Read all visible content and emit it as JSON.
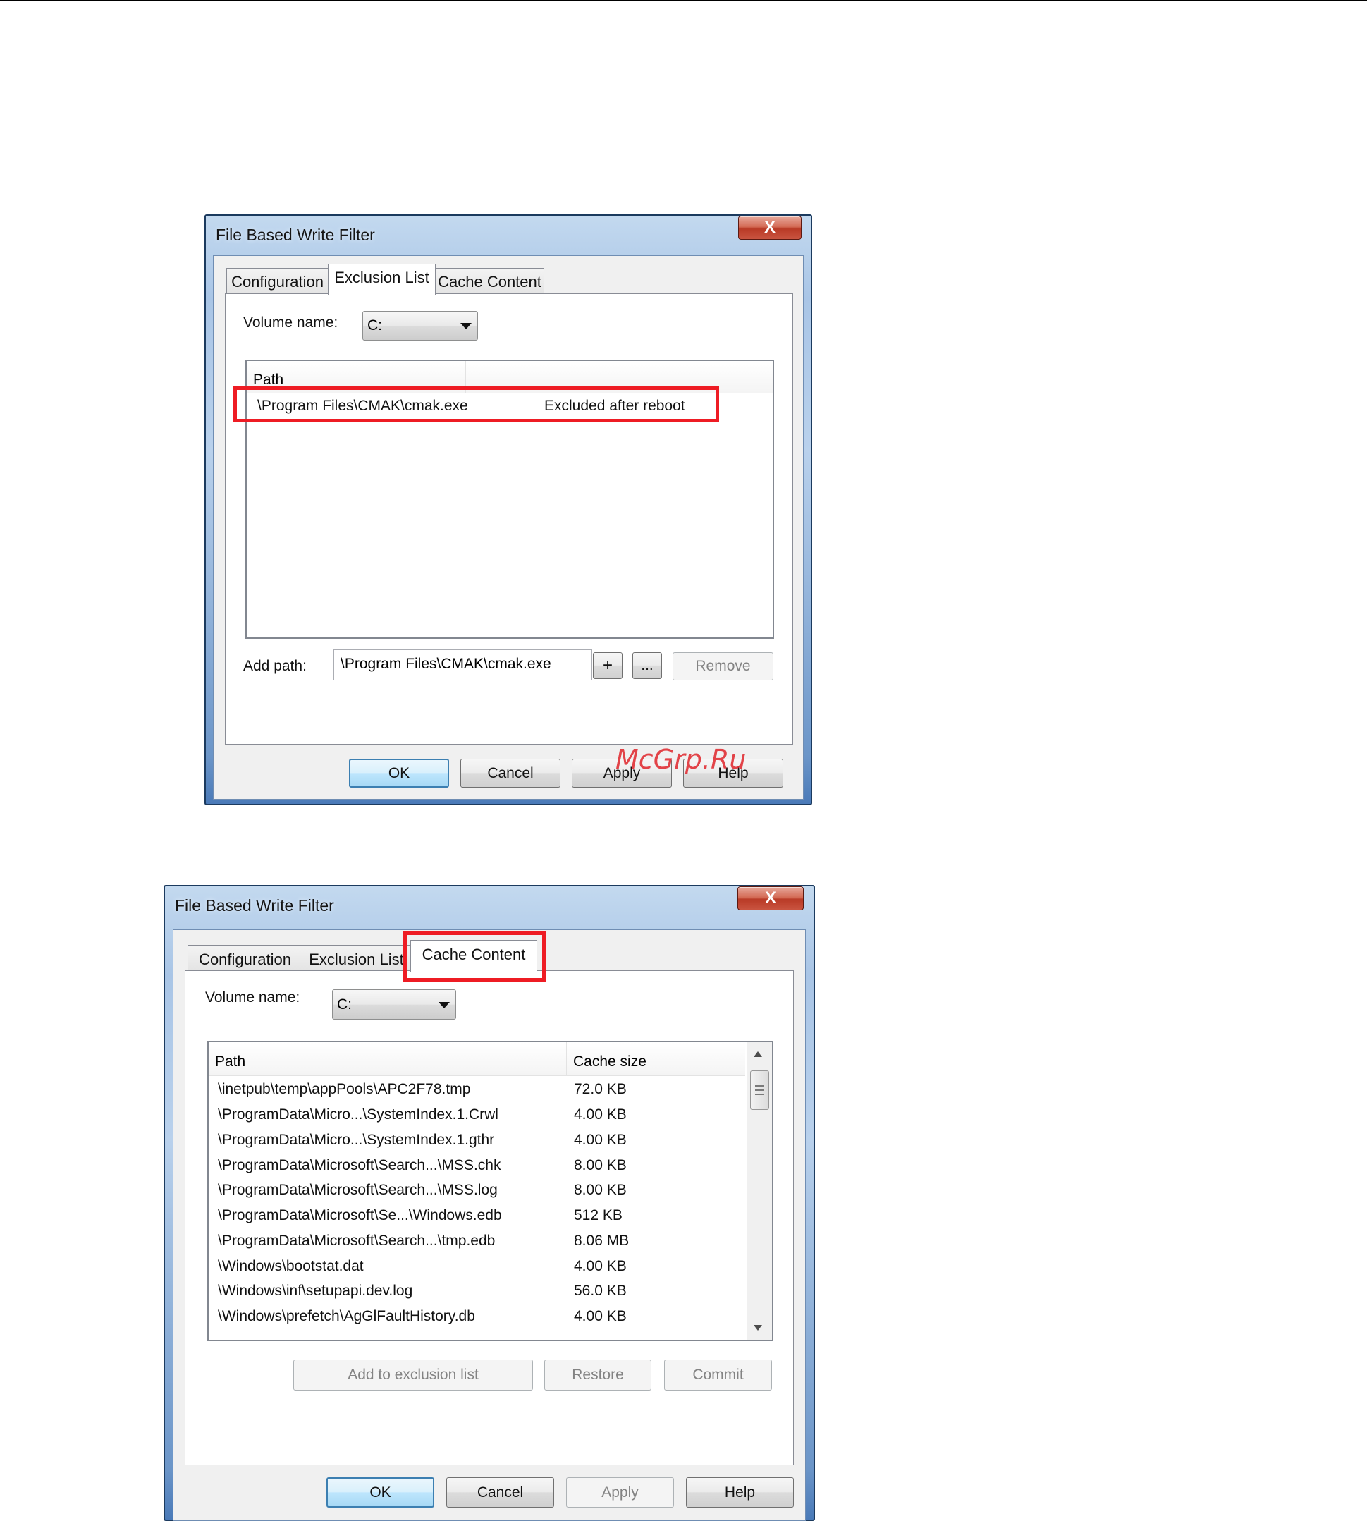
{
  "window_title": "File Based Write Filter",
  "close_glyph": "X",
  "tabs": [
    "Configuration",
    "Exclusion List",
    "Cache Content"
  ],
  "volume_label": "Volume name:",
  "volume_value": "C:",
  "watermark": "McGrp.Ru",
  "dialog1": {
    "list_header_path": "Path",
    "rows": [
      {
        "path": "\\Program Files\\CMAK\\cmak.exe",
        "status": "Excluded after reboot"
      }
    ],
    "add_path_label": "Add path:",
    "add_path_value": "\\Program Files\\CMAK\\cmak.exe",
    "add_button": "+",
    "browse_button": "...",
    "remove_button": "Remove",
    "buttons": {
      "ok": "OK",
      "cancel": "Cancel",
      "apply": "Apply",
      "help": "Help"
    }
  },
  "dialog2": {
    "header_path": "Path",
    "header_size": "Cache size",
    "rows": [
      {
        "path": "\\inetpub\\temp\\appPools\\APC2F78.tmp",
        "size": "72.0 KB"
      },
      {
        "path": "\\ProgramData\\Micro...\\SystemIndex.1.Crwl",
        "size": "4.00 KB"
      },
      {
        "path": "\\ProgramData\\Micro...\\SystemIndex.1.gthr",
        "size": "4.00 KB"
      },
      {
        "path": "\\ProgramData\\Microsoft\\Search...\\MSS.chk",
        "size": "8.00 KB"
      },
      {
        "path": "\\ProgramData\\Microsoft\\Search...\\MSS.log",
        "size": "8.00 KB"
      },
      {
        "path": "\\ProgramData\\Microsoft\\Se...\\Windows.edb",
        "size": "512 KB"
      },
      {
        "path": "\\ProgramData\\Microsoft\\Search...\\tmp.edb",
        "size": "8.06 MB"
      },
      {
        "path": "\\Windows\\bootstat.dat",
        "size": "4.00 KB"
      },
      {
        "path": "\\Windows\\inf\\setupapi.dev.log",
        "size": "56.0 KB"
      },
      {
        "path": "\\Windows\\prefetch\\AgGlFaultHistory.db",
        "size": "4.00 KB"
      }
    ],
    "action_buttons": {
      "add_exclusion": "Add to exclusion list",
      "restore": "Restore",
      "commit": "Commit"
    },
    "buttons": {
      "ok": "OK",
      "cancel": "Cancel",
      "apply": "Apply",
      "help": "Help"
    }
  }
}
